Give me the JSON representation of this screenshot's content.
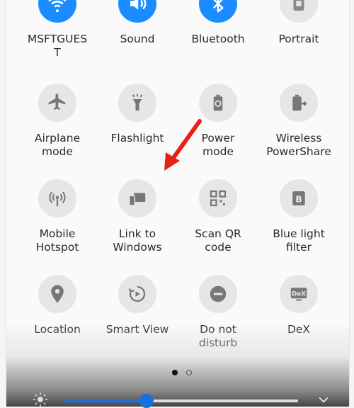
{
  "tiles": [
    {
      "label": "MSFTGUES\nT",
      "icon": "wifi-icon",
      "active": true
    },
    {
      "label": "Sound",
      "icon": "sound-icon",
      "active": true
    },
    {
      "label": "Bluetooth",
      "icon": "bluetooth-icon",
      "active": true
    },
    {
      "label": "Portrait",
      "icon": "portrait-lock-icon",
      "active": false
    },
    {
      "label": "Airplane\nmode",
      "icon": "airplane-icon",
      "active": false
    },
    {
      "label": "Flashlight",
      "icon": "flashlight-icon",
      "active": false
    },
    {
      "label": "Power\nmode",
      "icon": "power-mode-icon",
      "active": false
    },
    {
      "label": "Wireless\nPowerShare",
      "icon": "wireless-powershare-icon",
      "active": false
    },
    {
      "label": "Mobile\nHotspot",
      "icon": "hotspot-icon",
      "active": false
    },
    {
      "label": "Link to\nWindows",
      "icon": "link-to-windows-icon",
      "active": false
    },
    {
      "label": "Scan QR\ncode",
      "icon": "qr-code-icon",
      "active": false
    },
    {
      "label": "Blue light\nfilter",
      "icon": "blue-light-filter-icon",
      "active": false
    },
    {
      "label": "Location",
      "icon": "location-icon",
      "active": false
    },
    {
      "label": "Smart View",
      "icon": "smart-view-icon",
      "active": false
    },
    {
      "label": "Do not\ndisturb",
      "icon": "do-not-disturb-icon",
      "active": false
    },
    {
      "label": "DeX",
      "icon": "dex-icon",
      "active": false
    }
  ],
  "brightness": {
    "level": 0.35
  },
  "colors": {
    "active": "#1a8cff",
    "arrow": "#e8201a"
  }
}
